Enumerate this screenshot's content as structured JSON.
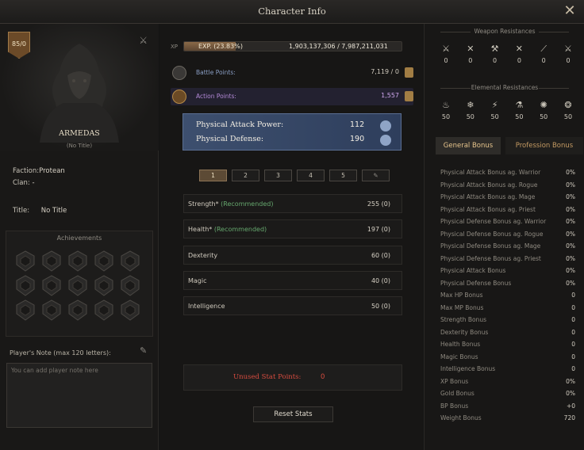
{
  "window": {
    "title": "Character Info"
  },
  "character": {
    "level": "85/0",
    "name": "ARMEDAS",
    "subtitle": "(No Title)",
    "faction_label": "Faction:",
    "faction": "Protean",
    "clan_label": "Clan:",
    "clan": "-",
    "title_label": "Title:",
    "title": "No Title"
  },
  "achievements": {
    "title": "Achievements"
  },
  "note": {
    "label": "Player's Note (max 120 letters):",
    "placeholder": "You can add player note here"
  },
  "xp": {
    "label": "XP",
    "percent_text": "EXP. (23.83%)",
    "progress": 0.2383,
    "value": "1,903,137,306 / 7,987,211,031"
  },
  "points": {
    "battle_label": "Battle Points:",
    "battle_value": "7,119 / 0",
    "action_label": "Action Points:",
    "action_value": "1,557"
  },
  "combat": {
    "attack_label": "Physical Attack Power:",
    "attack_value": "112",
    "defense_label": "Physical Defense:",
    "defense_value": "190"
  },
  "presets": [
    "1",
    "2",
    "3",
    "4",
    "5"
  ],
  "stats": [
    {
      "name": "Strength*",
      "rec": "(Recommended)",
      "value": "255 (0)"
    },
    {
      "name": "Health*",
      "rec": "(Recommended)",
      "value": "197 (0)"
    },
    {
      "name": "Dexterity",
      "rec": "",
      "value": "60 (0)"
    },
    {
      "name": "Magic",
      "rec": "",
      "value": "40 (0)"
    },
    {
      "name": "Intelligence",
      "rec": "",
      "value": "50 (0)"
    }
  ],
  "unused": {
    "label": "Unused Stat Points:",
    "value": "0"
  },
  "reset_label": "Reset Stats",
  "weapon_res": {
    "title": "Weapon Resistances",
    "values": [
      "0",
      "0",
      "0",
      "0",
      "0",
      "0"
    ]
  },
  "elemental_res": {
    "title": "Elemental Resistances",
    "values": [
      "50",
      "50",
      "50",
      "50",
      "50",
      "50"
    ]
  },
  "tabs": {
    "general": "General Bonus",
    "profession": "Profession Bonus"
  },
  "bonuses": [
    {
      "name": "Physical Attack Bonus ag. Warrior",
      "value": "0%"
    },
    {
      "name": "Physical Attack Bonus ag. Rogue",
      "value": "0%"
    },
    {
      "name": "Physical Attack Bonus ag. Mage",
      "value": "0%"
    },
    {
      "name": "Physical Attack Bonus ag. Priest",
      "value": "0%"
    },
    {
      "name": "Physical Defense Bonus ag. Warrior",
      "value": "0%"
    },
    {
      "name": "Physical Defense Bonus ag. Rogue",
      "value": "0%"
    },
    {
      "name": "Physical Defense Bonus ag. Mage",
      "value": "0%"
    },
    {
      "name": "Physical Defense Bonus ag. Priest",
      "value": "0%"
    },
    {
      "name": "Physical Attack Bonus",
      "value": "0%"
    },
    {
      "name": "Physical Defense Bonus",
      "value": "0%"
    },
    {
      "name": "Max HP Bonus",
      "value": "0"
    },
    {
      "name": "Max MP Bonus",
      "value": "0"
    },
    {
      "name": "Strength Bonus",
      "value": "0"
    },
    {
      "name": "Dexterity Bonus",
      "value": "0"
    },
    {
      "name": "Health Bonus",
      "value": "0"
    },
    {
      "name": "Magic Bonus",
      "value": "0"
    },
    {
      "name": "Intelligence Bonus",
      "value": "0"
    },
    {
      "name": "XP Bonus",
      "value": "0%"
    },
    {
      "name": "Gold Bonus",
      "value": "0%"
    },
    {
      "name": "BP Bonus",
      "value": "+0"
    },
    {
      "name": "Weight Bonus",
      "value": "720"
    }
  ]
}
